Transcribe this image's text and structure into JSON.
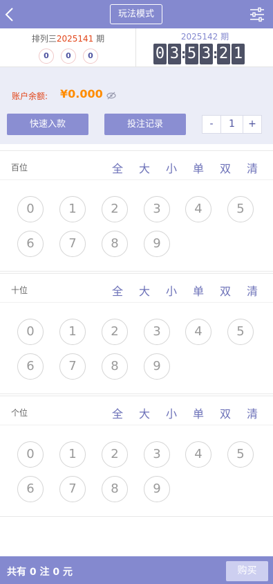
{
  "header": {
    "mode_label": "玩法模式"
  },
  "issue": {
    "prev_prefix": "排列三",
    "prev_number": "2025141",
    "prev_suffix": " 期",
    "prev_balls": [
      "0",
      "0",
      "0"
    ],
    "next_title": "2025142 期",
    "timer_digits": [
      "0",
      "3",
      "5",
      "3",
      "2",
      "1"
    ]
  },
  "account": {
    "balance_label": "账户余额:",
    "balance_value": "¥0.000",
    "deposit_label": "快速入款",
    "records_label": "投注记录",
    "stepper_minus": "-",
    "stepper_value": "1",
    "stepper_plus": "+"
  },
  "quick_labels": [
    "全",
    "大",
    "小",
    "单",
    "双",
    "清"
  ],
  "positions": [
    {
      "label": "百位",
      "numbers": [
        "0",
        "1",
        "2",
        "3",
        "4",
        "5",
        "6",
        "7",
        "8",
        "9"
      ]
    },
    {
      "label": "十位",
      "numbers": [
        "0",
        "1",
        "2",
        "3",
        "4",
        "5",
        "6",
        "7",
        "8",
        "9"
      ]
    },
    {
      "label": "个位",
      "numbers": [
        "0",
        "1",
        "2",
        "3",
        "4",
        "5",
        "6",
        "7",
        "8",
        "9"
      ]
    }
  ],
  "footer": {
    "summary": "共有 0 注  0 元",
    "buy_label": "购买"
  },
  "colors": {
    "header_bg": "#8489cf",
    "accent_red": "#e2461a",
    "balance_orange": "#ff8c00"
  }
}
